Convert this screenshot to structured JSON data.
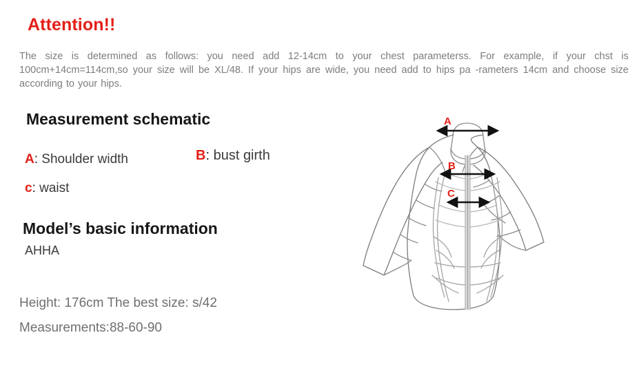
{
  "title": "Attention!!",
  "intro": "The size is determined as follows: you need add 12-14cm to your chest parameterss. For example, if your chst is 100cm+14cm=114cm,so your size will be XL/48. If your hips are wide, you need add to hips pa -rameters 14cm and choose size according to your hips.",
  "measurement_section": {
    "heading": "Measurement schematic",
    "legend": [
      {
        "key": "A",
        "colon": ":",
        "text": "Shoulder width"
      },
      {
        "key": "B",
        "colon": ":",
        "text": "bust girth"
      },
      {
        "key": "c",
        "colon": ":",
        "text": "waist"
      }
    ]
  },
  "model_section": {
    "heading": "Model’s basic information",
    "name": "AHHA",
    "height_line": "Height: 176cm  The best size: s/42",
    "measurements_line": "Measurements:88-60-90"
  },
  "diagram": {
    "name": "jacket-measurement-diagram",
    "arrow_labels": [
      "A",
      "B",
      "C"
    ],
    "arrows": [
      {
        "label": "A",
        "meaning": "Shoulder width"
      },
      {
        "label": "B",
        "meaning": "bust girth"
      },
      {
        "label": "C",
        "meaning": "waist"
      }
    ]
  },
  "colors": {
    "accent_red": "#e22018",
    "body_gray": "#7d7d7d",
    "heading_black": "#161616",
    "line_gray": "#808080",
    "arrow_black": "#111111"
  }
}
